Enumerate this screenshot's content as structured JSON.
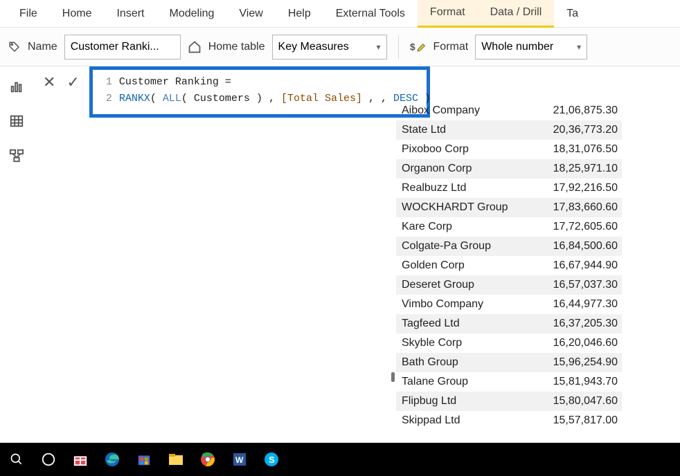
{
  "ribbon": {
    "tabs": [
      "File",
      "Home",
      "Insert",
      "Modeling",
      "View",
      "Help",
      "External Tools",
      "Format",
      "Data / Drill",
      "Ta"
    ],
    "activeIndex": 7
  },
  "formatBar": {
    "nameLabel": "Name",
    "nameValue": "Customer Ranki...",
    "homeTableLabel": "Home table",
    "homeTableValue": "Key Measures",
    "formatLabel": "Format",
    "formatValue": "Whole number"
  },
  "formula": {
    "line1_num": "1",
    "line1_a": "Customer Ranking =",
    "line2_num": "2",
    "line2_fn": "RANKX",
    "line2_p1": "( ",
    "line2_all": "ALL",
    "line2_p2": "( Customers ) , ",
    "line2_fld": "[Total Sales]",
    "line2_p3": " , , ",
    "line2_desc": "DESC",
    "line2_p4": " )"
  },
  "table": {
    "rows": [
      {
        "name": "Aibox Company",
        "value": "21,06,875.30"
      },
      {
        "name": "State Ltd",
        "value": "20,36,773.20"
      },
      {
        "name": "Pixoboo Corp",
        "value": "18,31,076.50"
      },
      {
        "name": "Organon Corp",
        "value": "18,25,971.10"
      },
      {
        "name": "Realbuzz Ltd",
        "value": "17,92,216.50"
      },
      {
        "name": "WOCKHARDT Group",
        "value": "17,83,660.60"
      },
      {
        "name": "Kare Corp",
        "value": "17,72,605.60"
      },
      {
        "name": "Colgate-Pa Group",
        "value": "16,84,500.60"
      },
      {
        "name": "Golden Corp",
        "value": "16,67,944.90"
      },
      {
        "name": "Deseret Group",
        "value": "16,57,037.30"
      },
      {
        "name": "Vimbo Company",
        "value": "16,44,977.30"
      },
      {
        "name": "Tagfeed Ltd",
        "value": "16,37,205.30"
      },
      {
        "name": "Skyble Corp",
        "value": "16,20,046.60"
      },
      {
        "name": "Bath Group",
        "value": "15,96,254.90"
      },
      {
        "name": "Talane Group",
        "value": "15,81,943.70"
      },
      {
        "name": "Flipbug Ltd",
        "value": "15,80,047.60"
      },
      {
        "name": "Skippad Ltd",
        "value": "15,57,817.00"
      }
    ]
  },
  "icons": {
    "x": "✕",
    "check": "✓"
  }
}
